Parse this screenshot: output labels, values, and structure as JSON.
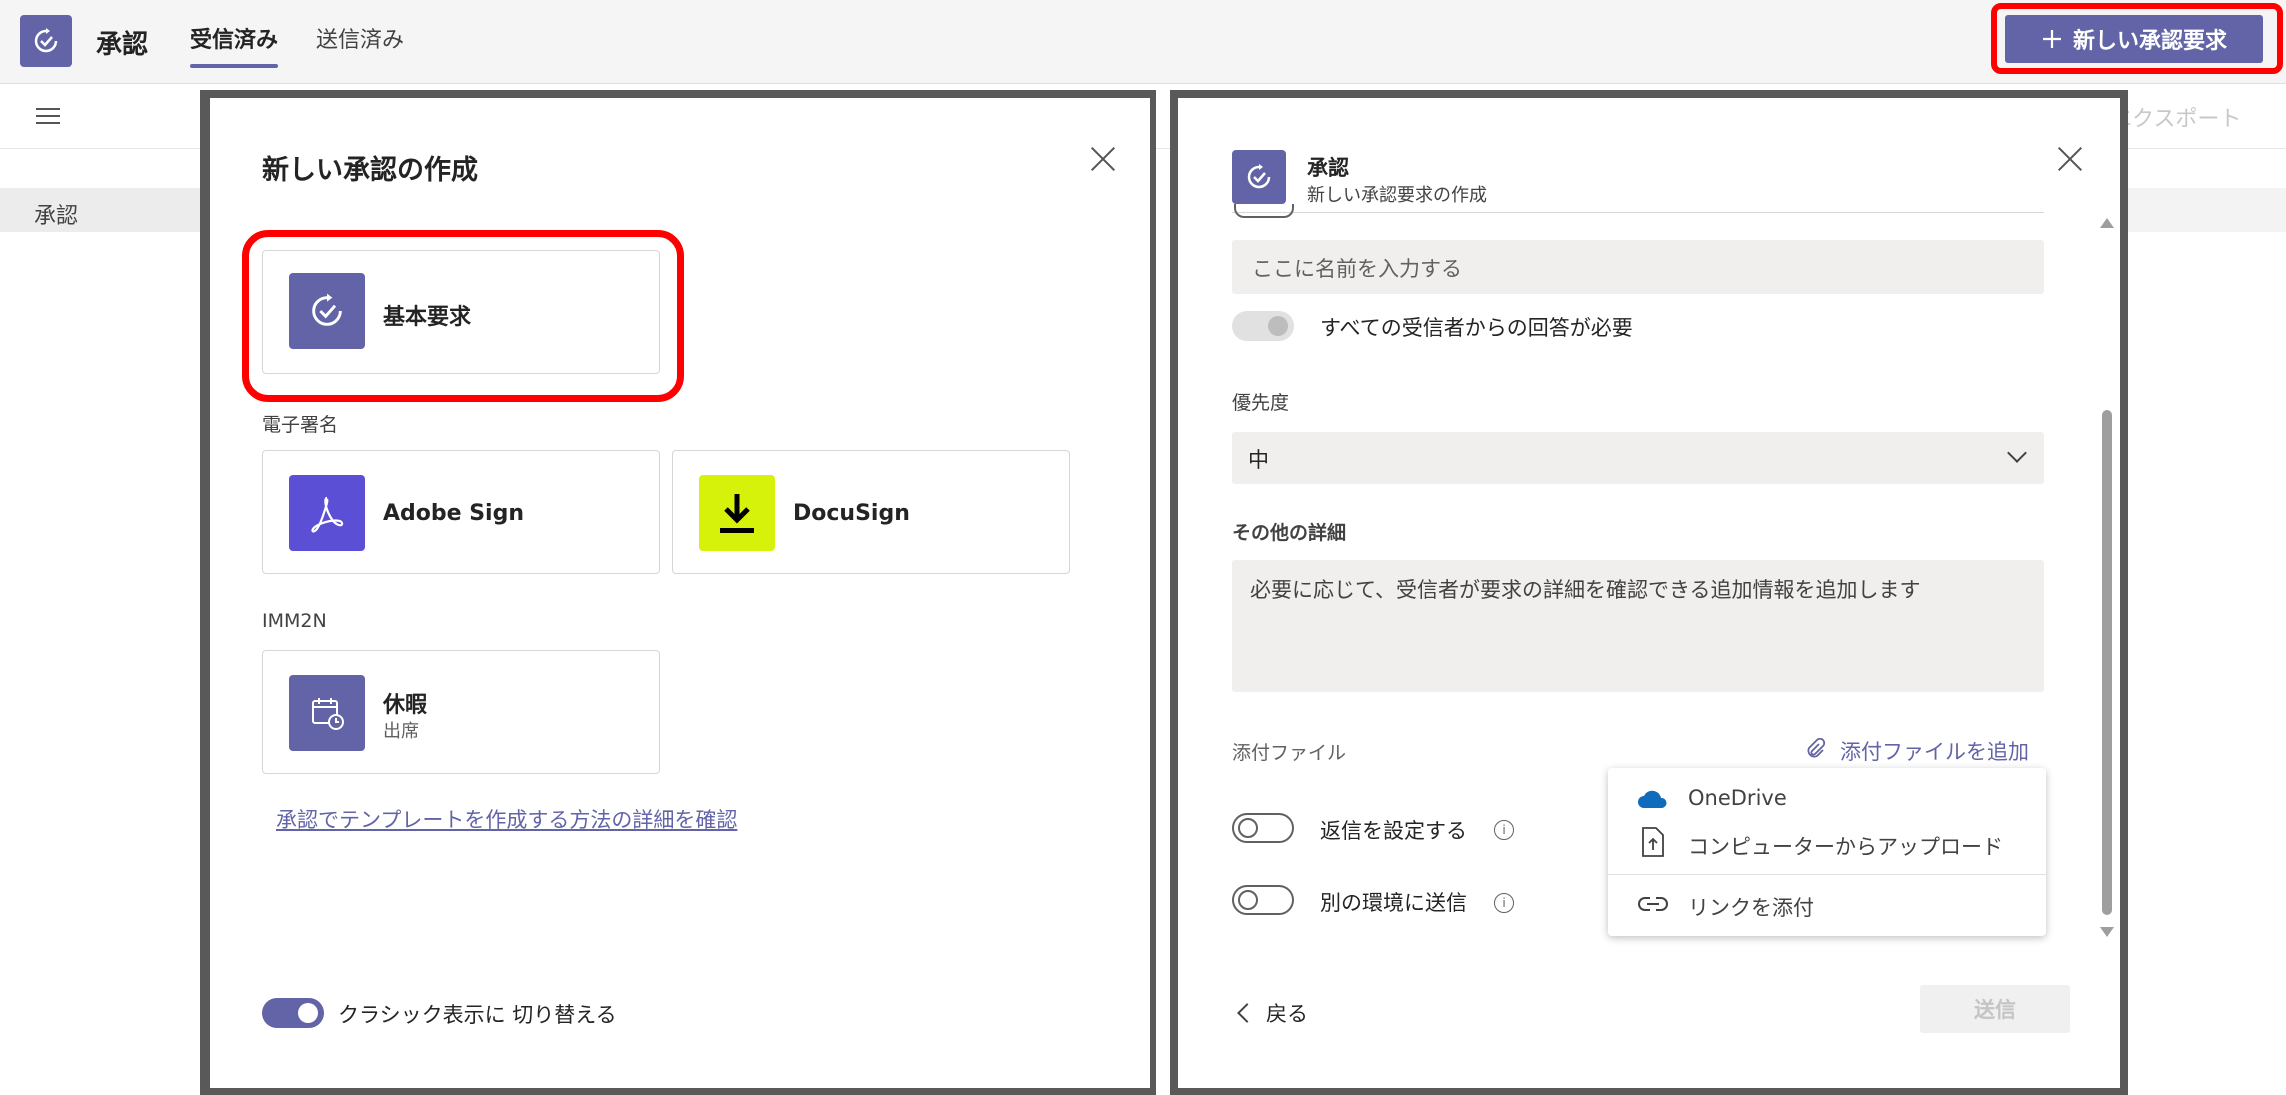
{
  "header": {
    "app_title": "承認",
    "tabs": [
      {
        "label": "受信済み"
      },
      {
        "label": "送信済み"
      }
    ],
    "new_request_label": "新しい承認要求",
    "export_label": "エクスポート"
  },
  "sidebar": {
    "item": "承認"
  },
  "left_dialog": {
    "title": "新しい承認の作成",
    "basic": {
      "label": "基本要求",
      "icon": "approval-icon"
    },
    "esign_section": "電子署名",
    "adobe": {
      "label": "Adobe Sign",
      "icon": "adobe-sign-icon",
      "color": "#5b4fd6"
    },
    "docusign": {
      "label": "DocuSign",
      "icon": "docusign-download-icon",
      "color": "#d7f20a"
    },
    "imm_section": "IMM2N",
    "leave": {
      "label": "休暇",
      "sub": "出席",
      "icon": "calendar-clock-icon"
    },
    "template_link": "承認でテンプレートを作成する方法の詳細を確認",
    "classic_toggle": "クラシック表示に 切り替える"
  },
  "right_dialog": {
    "title": "承認",
    "subtitle": "新しい承認要求の作成",
    "name_placeholder": "ここに名前を入力する",
    "require_all_label": "すべての受信者からの回答が必要",
    "priority_label": "優先度",
    "priority_value": "中",
    "details_label": "その他の詳細",
    "details_placeholder": "必要に応じて、受信者が要求の詳細を確認できる追加情報を追加します",
    "attachments_label": "添付ファイル",
    "add_attachment": "添付ファイルを追加",
    "reply_toggle": "返信を設定する",
    "env_toggle": "別の環境に送信",
    "menu": {
      "onedrive": "OneDrive",
      "upload": "コンピューターからアップロード",
      "link": "リンクを添付"
    },
    "back": "戻る",
    "send": "送信"
  },
  "colors": {
    "accent": "#6264a7",
    "highlight": "#ff0000"
  }
}
